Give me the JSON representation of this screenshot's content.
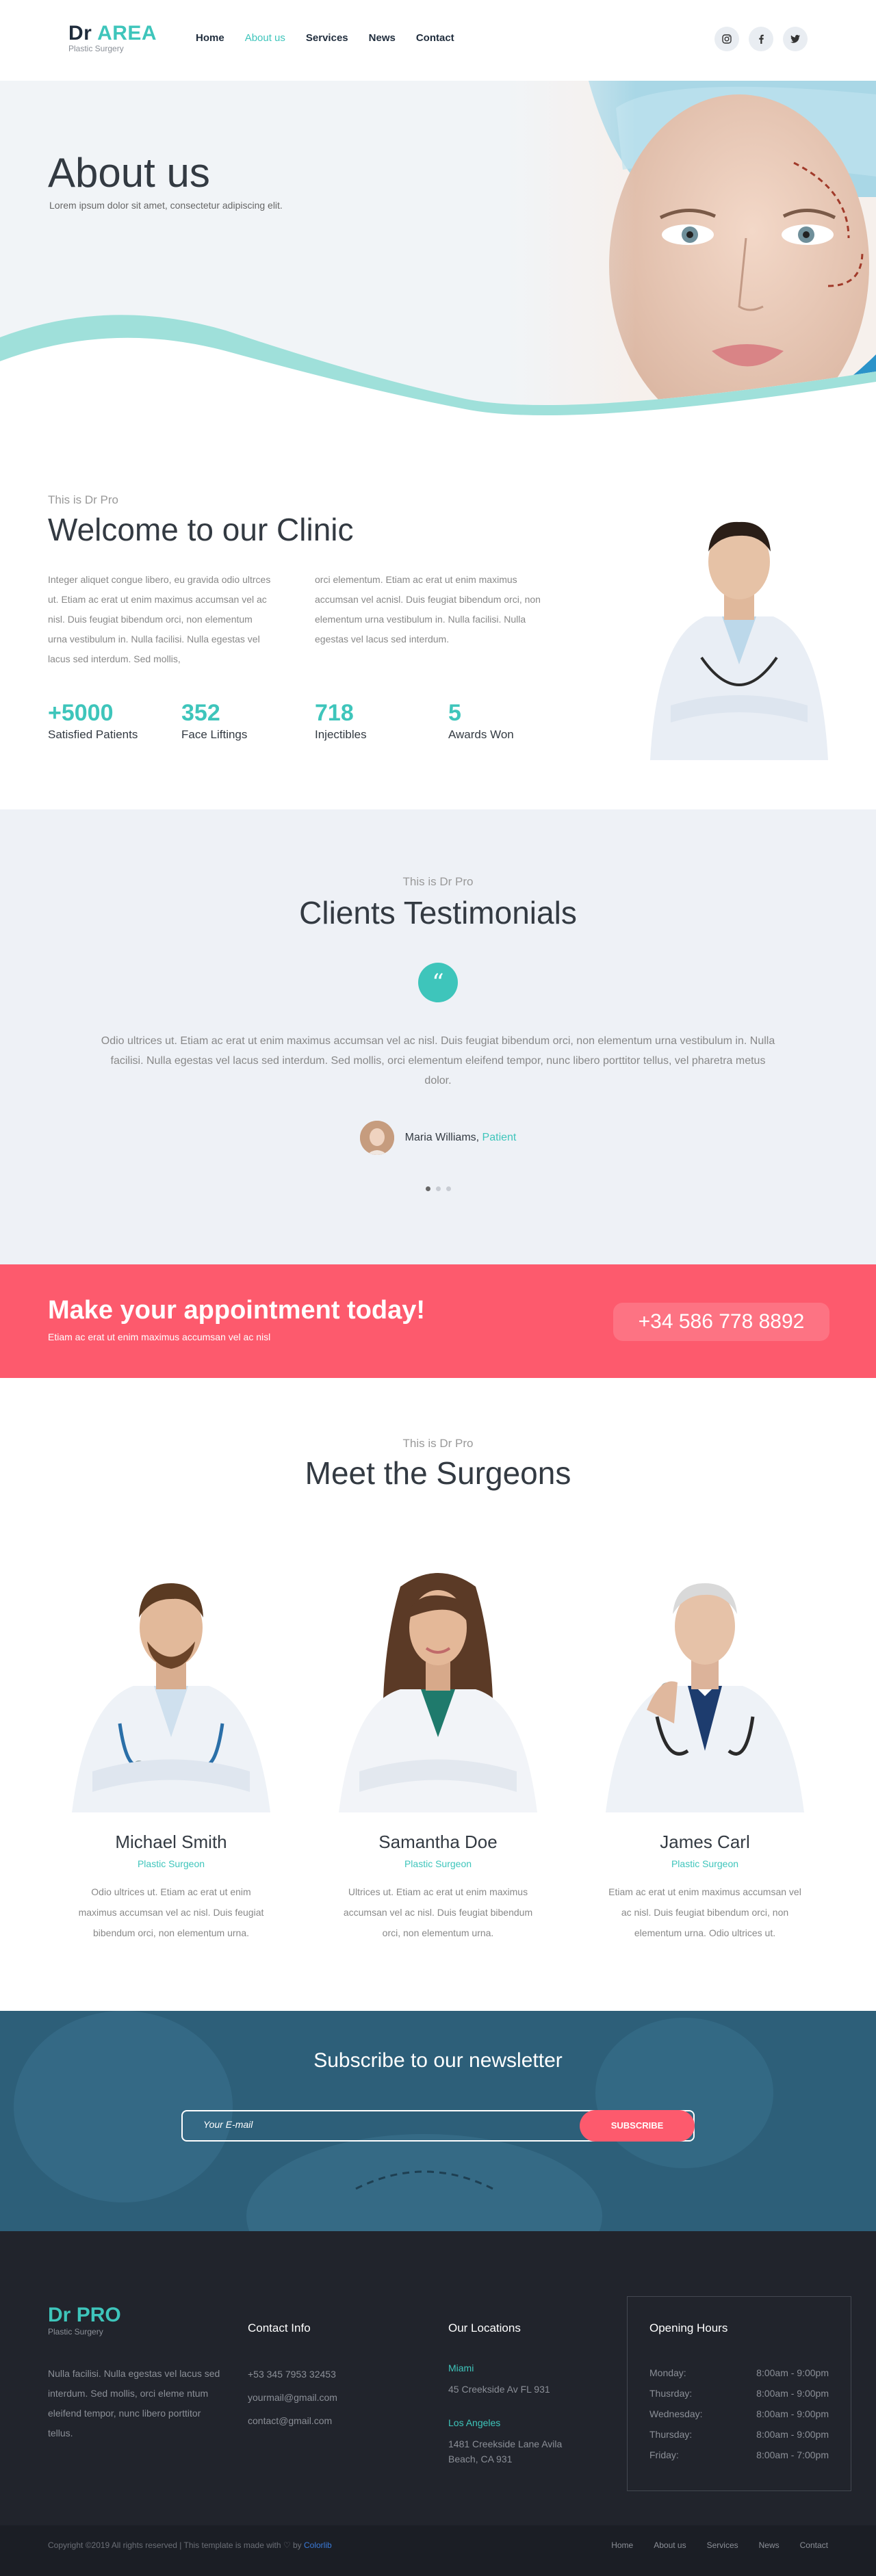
{
  "header": {
    "logo_main": "Dr ",
    "logo_accent": "AREA",
    "logo_sub": "Plastic Surgery",
    "nav": [
      "Home",
      "About us",
      "Services",
      "News",
      "Contact"
    ]
  },
  "hero": {
    "title": "About us",
    "subtitle": "Lorem ipsum dolor sit amet, consectetur adipiscing elit."
  },
  "welcome": {
    "eyebrow": "This is Dr Pro",
    "title": "Welcome to our Clinic",
    "col1": "Integer aliquet congue libero, eu gravida odio ultrces ut. Etiam ac erat ut enim maximus accumsan vel ac nisl. Duis feugiat bibendum orci, non elementum urna vestibulum in. Nulla facilisi. Nulla egestas vel lacus sed interdum. Sed mollis,",
    "col2": "orci elementum. Etiam ac erat ut enim maximus accumsan vel acnisl. Duis feugiat bibendum orci, non elementum urna vestibulum in. Nulla facilisi. Nulla egestas vel lacus sed interdum.",
    "stats": [
      {
        "num": "+5000",
        "label": "Satisfied Patients"
      },
      {
        "num": "352",
        "label": "Face Liftings"
      },
      {
        "num": "718",
        "label": "Injectibles"
      },
      {
        "num": "5",
        "label": "Awards Won"
      }
    ]
  },
  "testimonials": {
    "eyebrow": "This is Dr Pro",
    "title": "Clients Testimonials",
    "quote_glyph": "“",
    "body": "Odio ultrices ut. Etiam ac erat ut enim maximus accumsan vel ac nisl. Duis feugiat bibendum orci, non elementum urna vestibulum in. Nulla facilisi. Nulla egestas vel lacus sed interdum. Sed mollis, orci elementum eleifend tempor, nunc libero porttitor tellus, vel pharetra metus dolor.",
    "author_name": "Maria Williams,",
    "author_role": "Patient"
  },
  "appointment": {
    "title": "Make your appointment today!",
    "subtitle": "Etiam ac erat ut enim maximus accumsan vel ac nisl",
    "phone": "+34 586 778 8892"
  },
  "surgeons": {
    "eyebrow": "This is Dr Pro",
    "title": "Meet the Surgeons",
    "people": [
      {
        "name": "Michael Smith",
        "role": "Plastic Surgeon",
        "desc": "Odio ultrices ut. Etiam ac erat ut enim maximus accumsan vel ac nisl. Duis feugiat bibendum orci, non elementum urna."
      },
      {
        "name": "Samantha Doe",
        "role": "Plastic Surgeon",
        "desc": "Ultrices ut. Etiam ac erat ut enim maximus accumsan vel ac nisl. Duis feugiat bibendum orci, non elementum urna."
      },
      {
        "name": "James Carl",
        "role": "Plastic Surgeon",
        "desc": "Etiam ac erat ut enim maximus accumsan vel ac nisl. Duis feugiat bibendum orci, non elementum urna. Odio ultrices ut."
      }
    ]
  },
  "newsletter": {
    "title": "Subscribe to our newsletter",
    "placeholder": "Your E-mail",
    "button": "SUBSCRIBE"
  },
  "footer": {
    "logo_main": "Dr ",
    "logo_accent": "PRO",
    "logo_sub": "Plastic Surgery",
    "about": "Nulla facilisi. Nulla egestas vel lacus sed interdum. Sed mollis, orci eleme ntum eleifend tempor, nunc libero porttitor tellus.",
    "contact_title": "Contact Info",
    "contact": [
      "+53 345 7953 32453",
      "yourmail@gmail.com",
      "contact@gmail.com"
    ],
    "locations_title": "Our Locations",
    "locations": [
      {
        "city": "Miami",
        "addr": "45 Creekside Av FL 931"
      },
      {
        "city": "Los Angeles",
        "addr": "1481 Creekside Lane Avila Beach, CA 931"
      }
    ],
    "hours_title": "Opening Hours",
    "hours": [
      {
        "day": "Monday:",
        "time": "8:00am - 9:00pm"
      },
      {
        "day": "Thusrday:",
        "time": "8:00am - 9:00pm"
      },
      {
        "day": "Wednesday:",
        "time": "8:00am - 9:00pm"
      },
      {
        "day": "Thursday:",
        "time": "8:00am - 9:00pm"
      },
      {
        "day": "Friday:",
        "time": "8:00am - 7:00pm"
      }
    ],
    "copyright": "Copyright ©2019 All rights reserved | This template is made with ♡ by ",
    "copyright_link": "Colorlib",
    "bottom_nav": [
      "Home",
      "About us",
      "Services",
      "News",
      "Contact"
    ]
  },
  "colors": {
    "accent": "#3ec5bb",
    "appointment": "#fd5a6d",
    "footer": "#21242c",
    "newsletter": "#2d5f79"
  }
}
